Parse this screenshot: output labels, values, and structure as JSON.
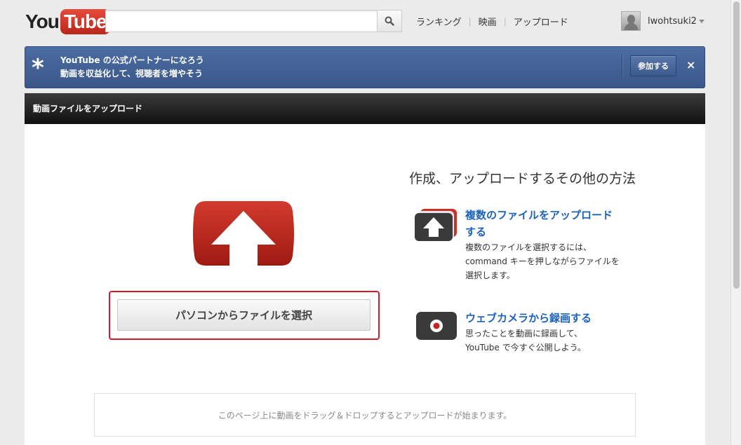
{
  "header": {
    "logo_you": "You",
    "logo_tube": "Tube",
    "search": {
      "value": "",
      "placeholder": ""
    },
    "nav": [
      {
        "label": "ランキング"
      },
      {
        "label": "映画"
      },
      {
        "label": "アップロード"
      }
    ],
    "username": "lwohtsuki2"
  },
  "banner": {
    "star": "*",
    "line1": "YouTube の公式パートナーになろう",
    "line2": "動画を収益化して、視聴者を増やそう",
    "join_label": "参加する",
    "close": "×"
  },
  "panel": {
    "title": "動画ファイルをアップロード",
    "select_button": "パソコンからファイルを選択",
    "other_methods_title": "作成、アップロードするその他の方法",
    "methods": [
      {
        "title_line1": "複数のファイルをアップロード",
        "title_line2": "する",
        "desc": [
          "複数のファイルを選択するには、",
          "command キーを押しながらファイルを",
          "選択します。"
        ],
        "icon": "multi-upload-icon"
      },
      {
        "title_line1": "ウェブカメラから録画する",
        "title_line2": "",
        "desc": [
          "思ったことを動画に録画して、",
          "YouTube で今すぐ公開しよう。"
        ],
        "icon": "webcam-record-icon"
      }
    ],
    "dropzone_text": "このページ上に動画をドラッグ＆ドロップするとアップロードが始まります。"
  },
  "colors": {
    "brand_red": "#cc181e",
    "banner_blue": "#3a5789",
    "link_blue": "#1c62b9",
    "highlight_red": "#d3192b"
  }
}
